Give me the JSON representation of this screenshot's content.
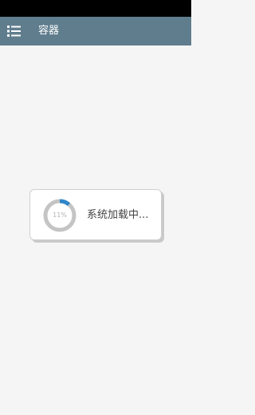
{
  "app_bar": {
    "title": "容器",
    "menu_icon": "list-menu-icon",
    "background_color": "#5f7d8d"
  },
  "status_bar": {
    "background_color": "#000000"
  },
  "loading_dialog": {
    "progress_percent": 11,
    "progress_label": "11%",
    "message": "系统加载中...",
    "ring_track_color": "#c4c4c4",
    "ring_progress_color": "#2f86c8"
  }
}
